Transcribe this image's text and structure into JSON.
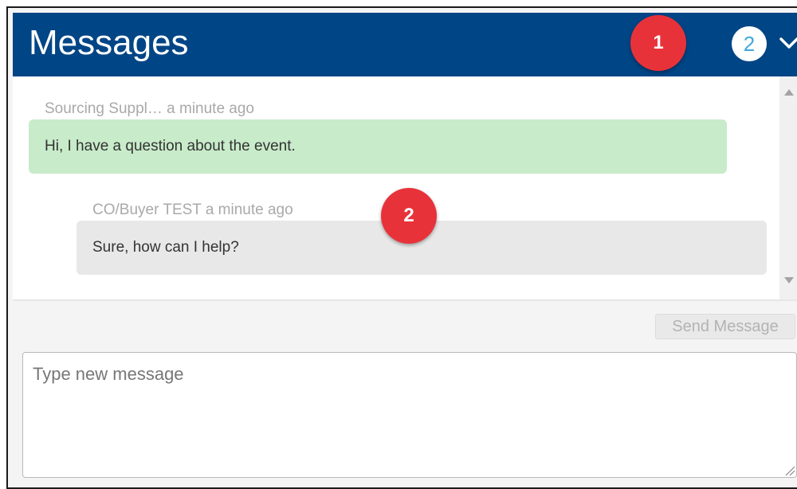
{
  "header": {
    "title": "Messages",
    "unread_count": "2",
    "collapse_icon": "chevron-down-icon",
    "background_color": "#004585"
  },
  "annotations": {
    "marker_1": "1",
    "marker_2": "2",
    "color": "#e8323a"
  },
  "thread": {
    "messages": [
      {
        "sender_meta": "Sourcing Suppl… a minute ago",
        "text": "Hi, I have a question about the event.",
        "bubble_color": "#c8ebc9"
      },
      {
        "sender_meta": "CO/Buyer TEST a minute ago",
        "text": "Sure, how can I help?",
        "bubble_color": "#e8e8e8"
      }
    ]
  },
  "composer": {
    "send_label": "Send Message",
    "placeholder": "Type new message",
    "value": ""
  }
}
